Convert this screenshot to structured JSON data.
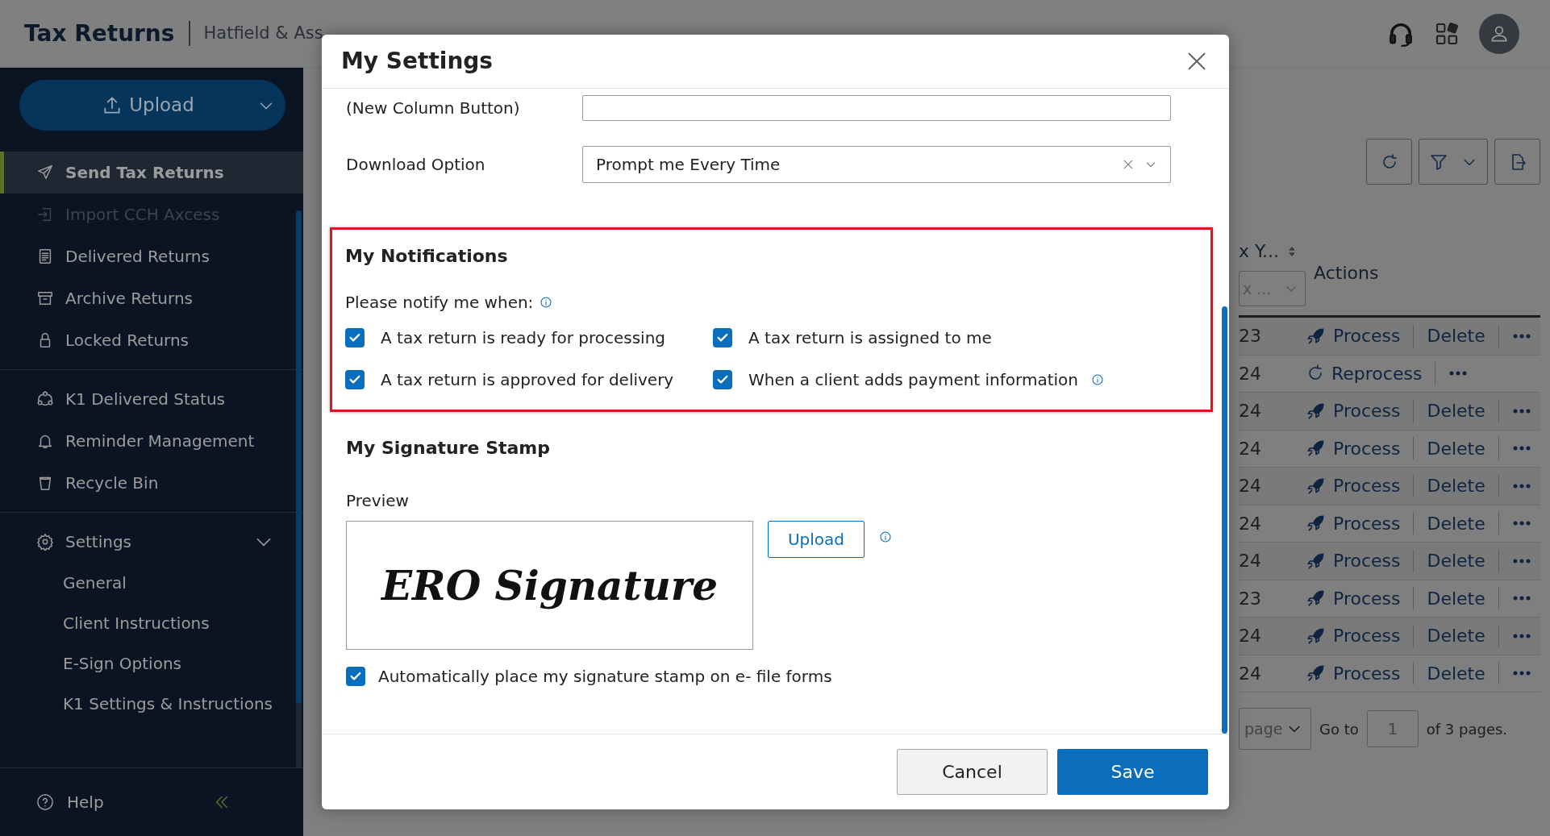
{
  "header": {
    "title": "Tax Returns",
    "subtitle": "Hatfield & Ass"
  },
  "sidebar": {
    "upload_button": "Upload",
    "sections": [
      [
        {
          "label": "Send Tax Returns",
          "selected": true,
          "disabled": false
        },
        {
          "label": "Import CCH Axcess",
          "selected": false,
          "disabled": true
        },
        {
          "label": "Delivered Returns",
          "selected": false,
          "disabled": false
        },
        {
          "label": "Archive Returns",
          "selected": false,
          "disabled": false
        },
        {
          "label": "Locked Returns",
          "selected": false,
          "disabled": false
        }
      ],
      [
        {
          "label": "K1 Delivered Status",
          "selected": false,
          "disabled": false
        },
        {
          "label": "Reminder Management",
          "selected": false,
          "disabled": false
        },
        {
          "label": "Recycle Bin",
          "selected": false,
          "disabled": false
        }
      ]
    ],
    "settings": {
      "label": "Settings",
      "expanded": true,
      "children": [
        {
          "label": "General"
        },
        {
          "label": "Client Instructions"
        },
        {
          "label": "E-Sign Options"
        },
        {
          "label": "K1 Settings & Instructions"
        }
      ]
    },
    "help": "Help"
  },
  "table": {
    "columns": [
      "x Y...",
      "Actions"
    ],
    "filter_placeholder": "x ...",
    "rows": [
      {
        "year": "23",
        "kind": "process",
        "action": "Process",
        "delete": "Delete"
      },
      {
        "year": "24",
        "kind": "reprocess",
        "action": "Reprocess"
      },
      {
        "year": "24",
        "kind": "process",
        "action": "Process",
        "delete": "Delete"
      },
      {
        "year": "24",
        "kind": "process",
        "action": "Process",
        "delete": "Delete"
      },
      {
        "year": "24",
        "kind": "process",
        "action": "Process",
        "delete": "Delete"
      },
      {
        "year": "24",
        "kind": "process",
        "action": "Process",
        "delete": "Delete"
      },
      {
        "year": "24",
        "kind": "process",
        "action": "Process",
        "delete": "Delete"
      },
      {
        "year": "23",
        "kind": "process",
        "action": "Process",
        "delete": "Delete"
      },
      {
        "year": "24",
        "kind": "process",
        "action": "Process",
        "delete": "Delete"
      },
      {
        "year": "24",
        "kind": "process",
        "action": "Process",
        "delete": "Delete"
      }
    ]
  },
  "pagination": {
    "page_size": "page",
    "goto_label": "Go to",
    "page": "1",
    "total": "of 3 pages."
  },
  "modal": {
    "title": "My Settings",
    "fields": [
      {
        "kind": "text",
        "label": "(New Column Button)"
      },
      {
        "kind": "select",
        "label": "Download Option",
        "value": "Prompt me Every Time"
      }
    ],
    "notifications": {
      "highlighted": true,
      "title": "My Notifications",
      "prompt": "Please notify me when:",
      "options": [
        {
          "label": "A tax return is ready for processing",
          "checked": true
        },
        {
          "label": "A tax return is assigned to me",
          "checked": true
        },
        {
          "label": "A tax return is approved for delivery",
          "checked": true
        },
        {
          "label": "When a client adds payment information",
          "checked": true,
          "info": true
        }
      ]
    },
    "signature": {
      "title": "My Signature Stamp",
      "preview_label": "Preview",
      "preview_text": "ERO Signature",
      "upload_button": "Upload",
      "auto_place": {
        "label": "Automatically place my signature stamp on e- file forms",
        "checked": true
      }
    },
    "buttons": [
      {
        "kind": "secondary",
        "label": "Cancel"
      },
      {
        "kind": "primary",
        "label": "Save"
      }
    ]
  }
}
